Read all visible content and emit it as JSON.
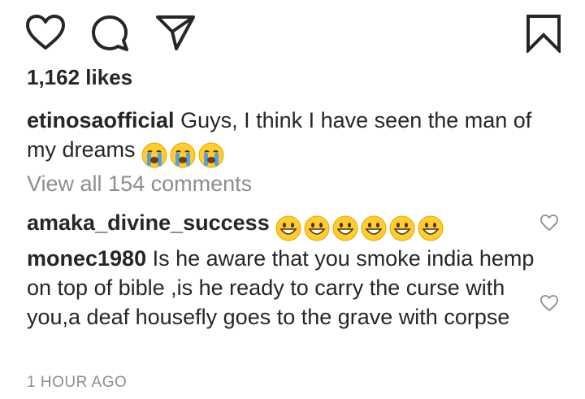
{
  "post": {
    "likes_text": "1,162 likes",
    "caption": {
      "username": "etinosaofficial",
      "text": "Guys, I think I have seen the man of my dreams",
      "emojis": [
        "crying-face-emoji",
        "crying-face-emoji",
        "crying-face-emoji"
      ]
    },
    "view_all_comments": "View all 154 comments",
    "comments": [
      {
        "username": "amaka_divine_success",
        "text": "",
        "emojis": [
          "grinning-face-emoji",
          "grinning-face-emoji",
          "grinning-face-emoji",
          "grinning-face-emoji",
          "grinning-face-emoji",
          "grinning-face-emoji"
        ]
      },
      {
        "username": "monec1980",
        "text": "Is he aware that you smoke india hemp on top of bible ,is he ready to carry the curse with you,a deaf housefly goes to the grave with corpse"
      }
    ],
    "timestamp": "1 HOUR AGO"
  },
  "actions": {
    "icons": [
      "heart-icon",
      "comment-icon",
      "share-icon",
      "bookmark-icon"
    ]
  },
  "colors": {
    "text": "#262626",
    "muted": "#8e8e8e",
    "emoji_yellow": "#ffcc33",
    "tear_blue": "#4fa3e0"
  }
}
